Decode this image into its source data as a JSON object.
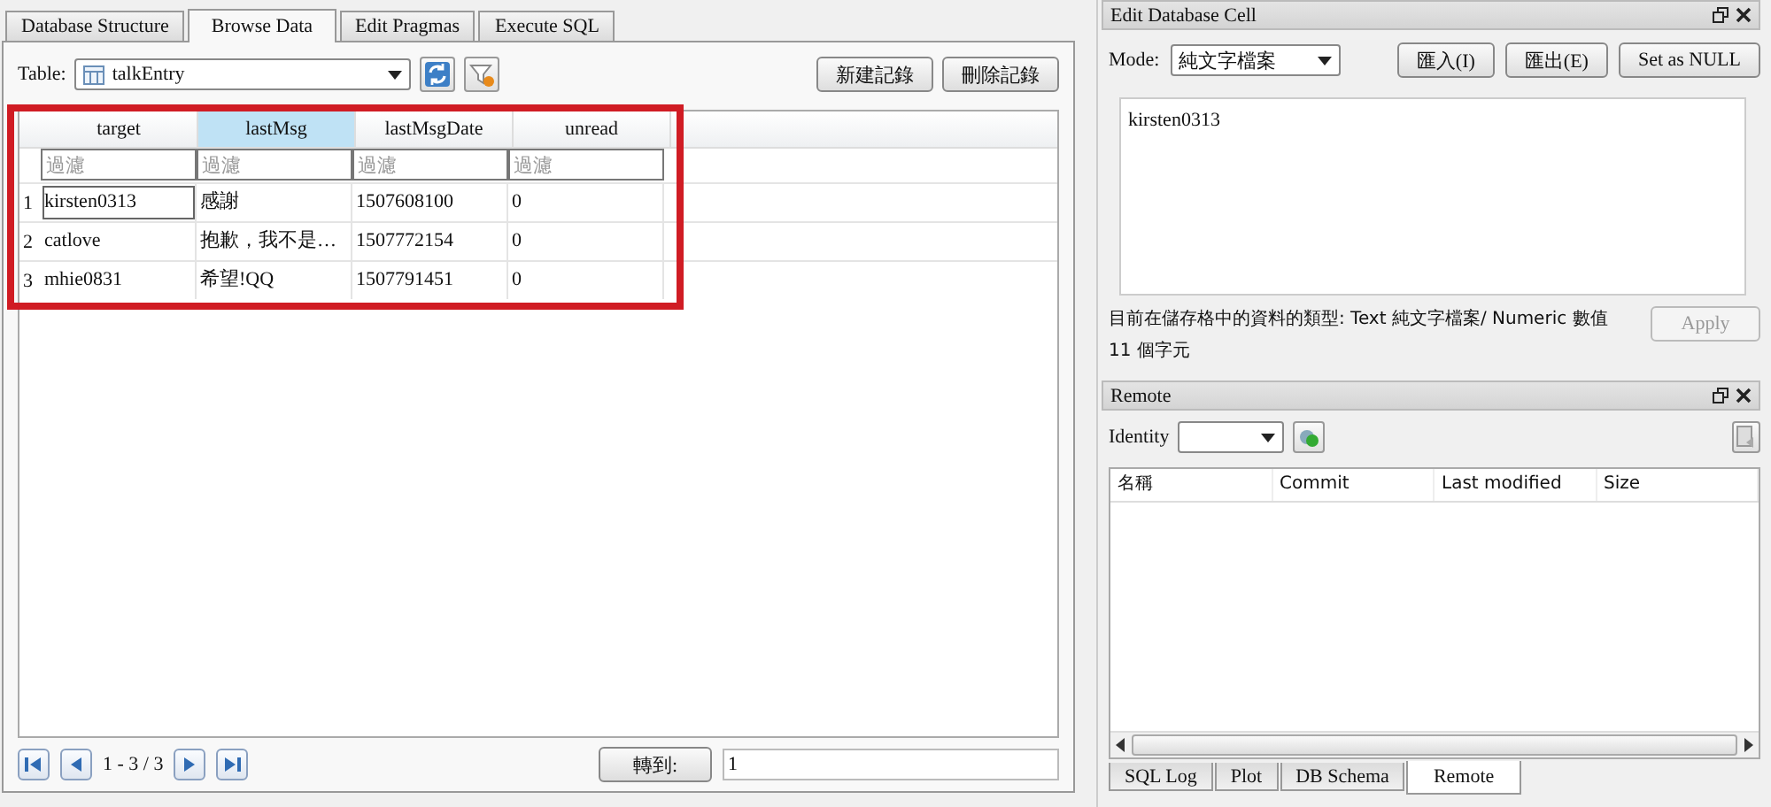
{
  "main_tabs": [
    {
      "label": "Database Structure",
      "selected": false
    },
    {
      "label": "Browse Data",
      "selected": true
    },
    {
      "label": "Edit Pragmas",
      "selected": false
    },
    {
      "label": "Execute SQL",
      "selected": false
    }
  ],
  "toolbar": {
    "table_label": "Table:",
    "table_name": "talkEntry",
    "buttons": [
      "新建記錄",
      "刪除記錄"
    ]
  },
  "grid": {
    "columns": [
      {
        "name": "target",
        "selected": false,
        "filter_placeholder": "過濾"
      },
      {
        "name": "lastMsg",
        "selected": true,
        "filter_placeholder": "過濾"
      },
      {
        "name": "lastMsgDate",
        "selected": false,
        "filter_placeholder": "過濾"
      },
      {
        "name": "unread",
        "selected": false,
        "filter_placeholder": "過濾"
      }
    ],
    "rows": [
      {
        "number": "1",
        "cells": [
          {
            "text": "kirsten0313",
            "focused": true
          },
          {
            "text": "感謝",
            "focused": false
          },
          {
            "text": "1507608100",
            "focused": false
          },
          {
            "text": "0",
            "focused": false
          }
        ]
      },
      {
        "number": "2",
        "cells": [
          {
            "text": "catlove",
            "focused": false
          },
          {
            "text": "抱歉，我不是…",
            "focused": false
          },
          {
            "text": "1507772154",
            "focused": false
          },
          {
            "text": "0",
            "focused": false
          }
        ]
      },
      {
        "number": "3",
        "cells": [
          {
            "text": "mhie0831",
            "focused": false
          },
          {
            "text": "希望!QQ",
            "focused": false
          },
          {
            "text": "1507791451",
            "focused": false
          },
          {
            "text": "0",
            "focused": false
          }
        ]
      }
    ]
  },
  "navigation": {
    "range": "1 - 3 / 3",
    "goto_button": "轉到:",
    "goto_value": "1"
  },
  "edit_cell": {
    "title": "Edit Database Cell",
    "mode_label": "Mode:",
    "mode": "純文字檔案",
    "buttons": [
      "匯入(I)",
      "匯出(E)",
      "Set as NULL"
    ],
    "value": "kirsten0313",
    "type_info": "目前在儲存格中的資料的類型: Text 純文字檔案/ Numeric 數值",
    "size_info": "11 個字元",
    "apply": {
      "label": "Apply",
      "disabled": true
    }
  },
  "remote": {
    "title": "Remote",
    "identity_label": "Identity",
    "columns": [
      "名稱",
      "Commit",
      "Last modified",
      "Size"
    ]
  },
  "bottom_tabs": [
    {
      "label": "SQL Log",
      "selected": false
    },
    {
      "label": "Plot",
      "selected": false
    },
    {
      "label": "DB Schema",
      "selected": false
    },
    {
      "label": "Remote",
      "selected": true
    }
  ]
}
